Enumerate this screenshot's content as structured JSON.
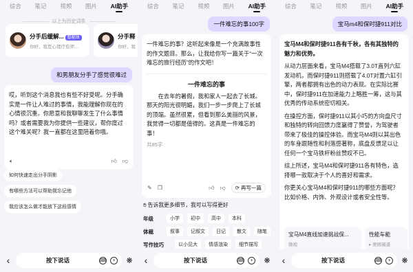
{
  "tabs": [
    "综合",
    "笔记",
    "视频",
    "图片",
    "AI助手"
  ],
  "bottom_bar": {
    "voice_label": "按下说话"
  },
  "pane1": {
    "history_label": "以上为历史词条",
    "personas": [
      {
        "title": "分手后缓解...",
        "badge": "智能体",
        "subtitle": "你好，我是心理疗愈师..."
      },
      {
        "title": "分手释",
        "subtitle": "你好，我"
      }
    ],
    "user_message": "和男朋友分手了感觉很难过",
    "reply": "哎，听到这个消息我也有些不好受呢。分手确实是一件让人难过的事情，我能理解你现在的心情很沉重。你愿意和我聊聊发生了什么事情吗？或者需要我为你提供一些建议，帮你度过这个难关呢？我一直都在这里陪着你哦。",
    "suggestions": [
      "如何快速走出分手阴影",
      "有哪些方法可以帮助我忘记他",
      "我应该怎么做才能放下这段感情"
    ]
  },
  "pane2": {
    "user_message": "一件难忘的事100字",
    "intro": "一件难忘的事？这听起来像是一个充满故事性的作文题目。那么，让我给你写一篇关于“一次难忘的旅行经历”的作文吧！",
    "essay_title": "一件难忘的事",
    "essay_body": "在去年的暑假，我和家人一起去了长城。那天的阳光很明媚，我们一步一步爬上了长城的顶端。虽然很累，但看到那么美丽的风景，我觉得一切都是值得的。这真是一件难忘的事！",
    "word_count": "共85字",
    "rewrite_label": "再写一篇",
    "details_prompt": "告诉我更多细节，我可以写得更好",
    "rows": [
      {
        "label": "年级",
        "chips": [
          "小学",
          "初中",
          "高中",
          "本科"
        ]
      },
      {
        "label": "体裁",
        "chips": [
          "叙事",
          "记叙文",
          "日记",
          "散文",
          "随笔"
        ]
      },
      {
        "label": "写作技巧",
        "chips": [
          "以小见大",
          "情感渲染",
          "细节描写"
        ]
      }
    ]
  },
  "pane3": {
    "user_message": "宝马m4和保时捷911对比",
    "headline": "宝马M4和保时捷911各有千秋，各有其独特的魅力和优势。",
    "paragraphs": [
      "从动力层面来看，宝马M4搭载了3.0T直列六缸发动机，而保时捷911则搭载了4.0T对置六缸引擎，两者都拥有出色的动力表现。在实际比赛中，保时捷911在加速能力上略胜一筹，这与其优秀的传动系统密切相关。",
      "在操控方面，保时捷911以其小巧的方向盘尺寸和独特的转向回馈力度赢得了赞誉，为驾驶者带来了极佳的操控体验。而宝马M4则以其出色的车身跟随性和利落感著称，底盘反馈足以让任何一个宝马铁杆粉丝赞叹不已。",
      "综上所述，宝马M4和保时捷911各有特色，选择哪一款取决于个人的喜好和需求。",
      "你更关心宝马M4和保时捷911的哪些方面呢？比如价格、内饰、外观设计或者安全性等。"
    ],
    "refs": [
      {
        "title": "宝马M4直线加速挑战保...",
        "source": "微视"
      },
      {
        "title": "性能车能",
        "source": "吴佩锡道"
      }
    ]
  },
  "colors": {
    "accent": "#6b5ef8",
    "user_bubble": "#dcd8ff",
    "background": "#f4f5f9"
  }
}
